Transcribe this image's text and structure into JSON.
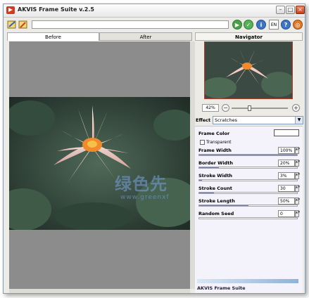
{
  "window": {
    "title": "AKVIS Frame Suite v.2.5"
  },
  "toolbar": {
    "path_value": "",
    "language": "EN"
  },
  "tabs": [
    {
      "label": "Before"
    },
    {
      "label": "After"
    }
  ],
  "navigator": {
    "label": "Navigator",
    "zoom": "42%"
  },
  "effect": {
    "label": "Effect",
    "selected": "Scratches"
  },
  "params": {
    "frame_color_label": "Frame Color",
    "transparent_label": "Transparent",
    "transparent_checked": false,
    "sliders": [
      {
        "label": "Frame Width",
        "value": "100%",
        "level": 1.0
      },
      {
        "label": "Border Width",
        "value": "20%",
        "level": 0.2
      },
      {
        "label": "Stroke Width",
        "value": "3%",
        "level": 0.03
      },
      {
        "label": "Stroke Count",
        "value": "30",
        "level": 0.15
      },
      {
        "label": "Stroke Length",
        "value": "50%",
        "level": 0.5
      },
      {
        "label": "Random Seed",
        "value": "0",
        "level": 0.0
      }
    ]
  },
  "footer": {
    "label": "AKVIS Frame Suite"
  },
  "watermark": {
    "text": "绿色先",
    "url": "www.greenxf"
  },
  "colors": {
    "accent": "#d23b1e",
    "frame_color": "#ffffff",
    "slider_fill": "#7a7e9e"
  }
}
